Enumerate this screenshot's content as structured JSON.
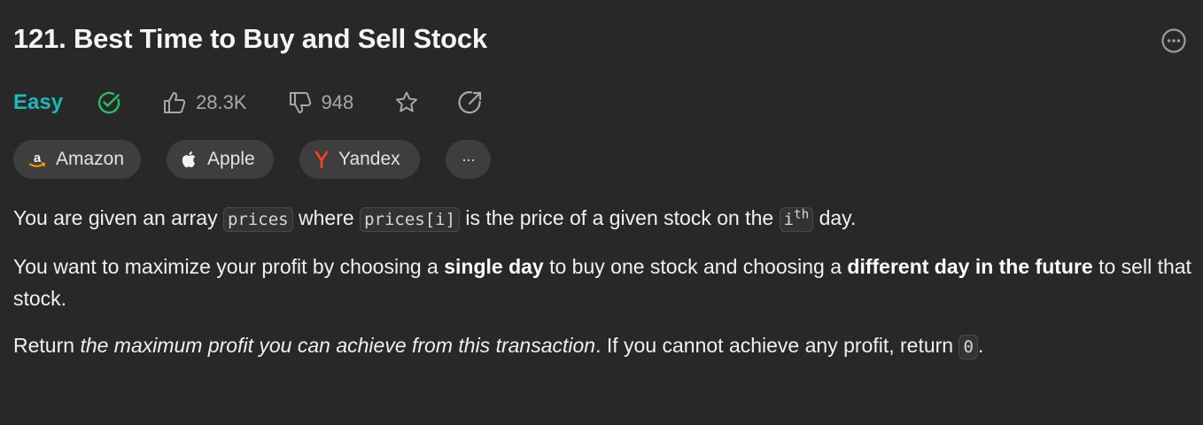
{
  "problem": {
    "title": "121. Best Time to Buy and Sell Stock"
  },
  "meta": {
    "difficulty": "Easy",
    "difficulty_color": "#1cb8b8",
    "solved_color": "#2cbb5d",
    "likes": "28.3K",
    "dislikes": "948",
    "icons": [
      "check-circle-icon",
      "thumbs-up-icon",
      "thumbs-down-icon",
      "star-icon",
      "share-icon",
      "more-horizontal-icon"
    ]
  },
  "companies": [
    {
      "label": "Amazon",
      "icon": "amazon-logo"
    },
    {
      "label": "Apple",
      "icon": "apple-logo"
    },
    {
      "label": "Yandex",
      "icon": "yandex-logo"
    }
  ],
  "more_tags_label": "···",
  "description": {
    "p1": {
      "t1": "You are given an array ",
      "c1": "prices",
      "t2": " where ",
      "c2": "prices[i]",
      "t3": " is the price of a given stock on the ",
      "c3": "i",
      "c3_sup": "th",
      "t4": " day."
    },
    "p2": {
      "t1": "You want to maximize your profit by choosing a ",
      "b1": "single day",
      "t2": " to buy one stock and choosing a ",
      "b2": "different day in the future",
      "t3": " to sell that stock."
    },
    "p3": {
      "t1": "Return ",
      "i1": "the maximum profit you can achieve from this transaction",
      "t2": ". If you cannot achieve any profit, return ",
      "c1": "0",
      "t3": "."
    }
  }
}
